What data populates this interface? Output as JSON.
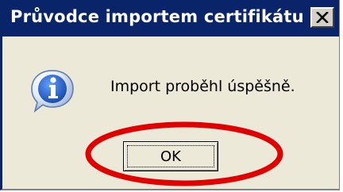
{
  "dialog": {
    "title": "Průvodce importem certifikátu",
    "message": "Import proběhl úspěšně.",
    "ok_label": "OK",
    "icons": {
      "message_icon": "information-icon",
      "close_icon": "close-icon"
    }
  },
  "annotation": {
    "highlight": "red-ellipse",
    "highlight_color": "#e00000"
  },
  "colors": {
    "titlebar": "#0a246a",
    "dialog_background": "#ece9d8",
    "info_blue": "#1a5fd0"
  }
}
